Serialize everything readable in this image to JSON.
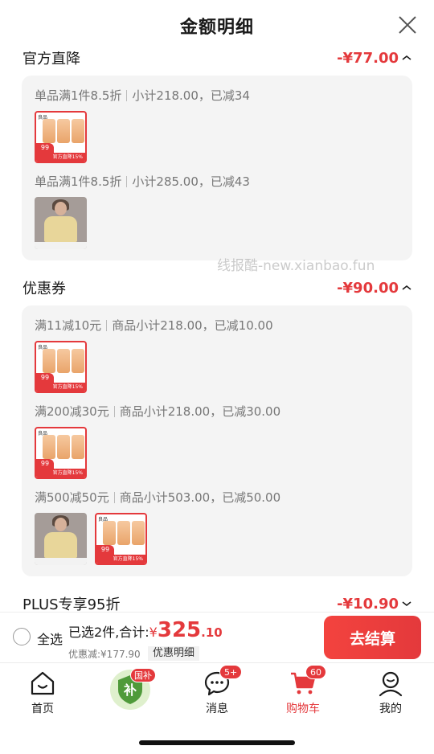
{
  "sheet": {
    "title": "金额明细"
  },
  "sections": [
    {
      "title": "官方直降",
      "amount": "-¥77.00",
      "groups": [
        {
          "rule": [
            "单品满1件8.5折",
            "小计218.00，已减34"
          ],
          "items": [
            "product-pack"
          ]
        },
        {
          "rule": [
            "单品满1件8.5折",
            "小计285.00，已减43"
          ],
          "items": [
            "tshirt"
          ]
        }
      ]
    },
    {
      "title": "优惠券",
      "amount": "-¥90.00",
      "groups": [
        {
          "rule": [
            "满11减10元",
            "商品小计218.00，已减10.00"
          ],
          "items": [
            "product-pack"
          ]
        },
        {
          "rule": [
            "满200减30元",
            "商品小计218.00，已减30.00"
          ],
          "items": [
            "product-pack"
          ]
        },
        {
          "rule": [
            "满500减50元",
            "商品小计503.00，已减50.00"
          ],
          "items": [
            "tshirt",
            "product-pack"
          ]
        }
      ]
    },
    {
      "title": "PLUS专享95折",
      "amount": "-¥10.90",
      "groups": []
    }
  ],
  "product_thumb": {
    "brand": "良品",
    "price": "99",
    "banner": "官方直降15%"
  },
  "watermark": "线报酷-new.xianbao.fun",
  "bottom_bar": {
    "select_all": "全选",
    "selected_prefix": "已选2件,合计:",
    "total_symbol": "¥",
    "total_integer": "325",
    "total_decimal": ".10",
    "discount_text": "优惠减:¥177.90",
    "detail_label": "优惠明细",
    "checkout_label": "去结算"
  },
  "tabbar": {
    "home": "首页",
    "subsidy_badge": "国补",
    "subsidy_char": "补",
    "messages": "消息",
    "messages_badge": "5+",
    "cart": "购物车",
    "cart_badge": "60",
    "me": "我的"
  },
  "colors": {
    "accent": "#e4393c"
  }
}
